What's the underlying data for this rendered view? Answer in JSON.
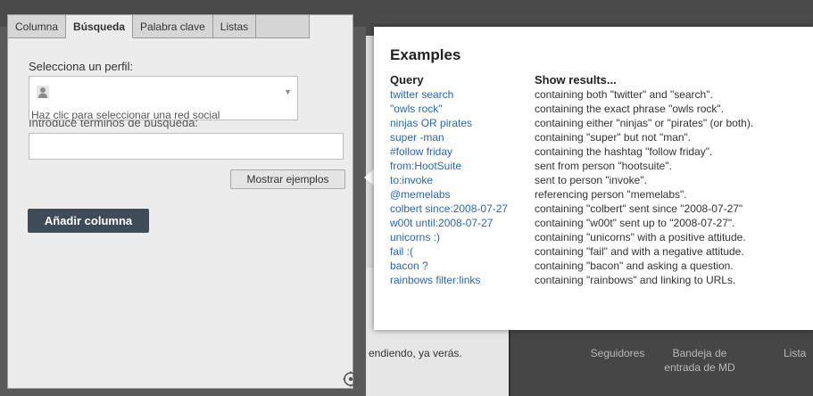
{
  "panel": {
    "tabs": [
      "Columna",
      "Búsqueda",
      "Palabra clave",
      "Listas"
    ],
    "profile_label": "Selecciona un perfil:",
    "profile_hint": "Haz clic para seleccionar una red social",
    "search_label": "Introduce términos de búsqueda:",
    "search_value": "",
    "examples_button": "Mostrar ejemplos",
    "add_button": "Añadir columna"
  },
  "background": {
    "content_text": "endiendo, ya verás.",
    "stats": [
      "Seguidores",
      "Bandeja de entrada de MD",
      "Lista"
    ]
  },
  "popup": {
    "title": "Examples",
    "header_query": "Query",
    "header_results": "Show results...",
    "examples": [
      {
        "query": "twitter search",
        "desc": "containing both \"twitter\" and \"search\"."
      },
      {
        "query": "\"owls rock\"",
        "desc": "containing the exact phrase \"owls rock\"."
      },
      {
        "query": "ninjas OR pirates",
        "desc": "containing either \"ninjas\" or \"pirates\" (or both)."
      },
      {
        "query": "super -man",
        "desc": "containing \"super\" but not \"man\"."
      },
      {
        "query": "#follow friday",
        "desc": "containing the hashtag \"follow friday\"."
      },
      {
        "query": "from:HootSuite",
        "desc": "sent from person \"hootsuite\"."
      },
      {
        "query": "to:invoke",
        "desc": "sent to person \"invoke\"."
      },
      {
        "query": "@memelabs",
        "desc": "referencing person \"memelabs\"."
      },
      {
        "query": "colbert since:2008-07-27",
        "desc": "containing \"colbert\" sent since \"2008-07-27\""
      },
      {
        "query": "w00t until:2008-07-27",
        "desc": "containing \"w00t\" sent up to \"2008-07-27\"."
      },
      {
        "query": "unicorns :)",
        "desc": "containing \"unicorns\" with a positive attitude."
      },
      {
        "query": "fail :(",
        "desc": "containing \"fail\" and with a negative attitude."
      },
      {
        "query": "bacon ?",
        "desc": "containing \"bacon\" and asking a question."
      },
      {
        "query": "rainbows filter:links",
        "desc": "containing \"rainbows\" and linking to URLs."
      }
    ]
  },
  "colors": {
    "link": "#2c68a8",
    "primary_button": "#3f4b57",
    "panel_bg": "#ececec"
  }
}
